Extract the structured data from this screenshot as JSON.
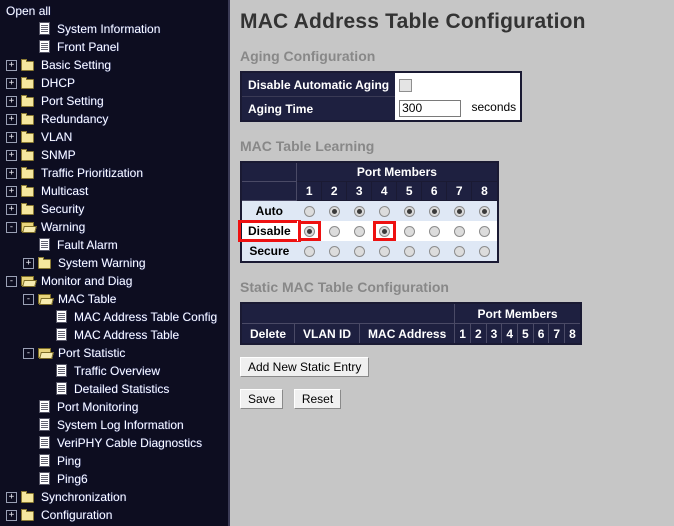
{
  "sidebar": {
    "open_all": "Open all",
    "items": [
      {
        "label": "System Information",
        "icon": "page-icon",
        "toggle": "none",
        "indent": 1
      },
      {
        "label": "Front Panel",
        "icon": "page-icon",
        "toggle": "none",
        "indent": 1
      },
      {
        "label": "Basic Setting",
        "icon": "folder-icon",
        "toggle": "+",
        "indent": 0
      },
      {
        "label": "DHCP",
        "icon": "folder-icon",
        "toggle": "+",
        "indent": 0
      },
      {
        "label": "Port Setting",
        "icon": "folder-icon",
        "toggle": "+",
        "indent": 0
      },
      {
        "label": "Redundancy",
        "icon": "folder-icon",
        "toggle": "+",
        "indent": 0
      },
      {
        "label": "VLAN",
        "icon": "folder-icon",
        "toggle": "+",
        "indent": 0
      },
      {
        "label": "SNMP",
        "icon": "folder-icon",
        "toggle": "+",
        "indent": 0
      },
      {
        "label": "Traffic Prioritization",
        "icon": "folder-icon",
        "toggle": "+",
        "indent": 0
      },
      {
        "label": "Multicast",
        "icon": "folder-icon",
        "toggle": "+",
        "indent": 0
      },
      {
        "label": "Security",
        "icon": "folder-icon",
        "toggle": "+",
        "indent": 0
      },
      {
        "label": "Warning",
        "icon": "folder-open-icon",
        "toggle": "-",
        "indent": 0
      },
      {
        "label": "Fault Alarm",
        "icon": "page-icon",
        "toggle": "none",
        "indent": 1
      },
      {
        "label": "System Warning",
        "icon": "folder-icon",
        "toggle": "+",
        "indent": 1
      },
      {
        "label": "Monitor and Diag",
        "icon": "folder-open-icon",
        "toggle": "-",
        "indent": 0
      },
      {
        "label": "MAC Table",
        "icon": "folder-open-icon",
        "toggle": "-",
        "indent": 1
      },
      {
        "label": "MAC Address Table Config",
        "icon": "page-icon",
        "toggle": "none",
        "indent": 2
      },
      {
        "label": "MAC Address Table",
        "icon": "page-icon",
        "toggle": "none",
        "indent": 2
      },
      {
        "label": "Port Statistic",
        "icon": "folder-open-icon",
        "toggle": "-",
        "indent": 1
      },
      {
        "label": "Traffic Overview",
        "icon": "page-icon",
        "toggle": "none",
        "indent": 2
      },
      {
        "label": "Detailed Statistics",
        "icon": "page-icon",
        "toggle": "none",
        "indent": 2
      },
      {
        "label": "Port Monitoring",
        "icon": "page-icon",
        "toggle": "none",
        "indent": 1
      },
      {
        "label": "System Log Information",
        "icon": "page-icon",
        "toggle": "none",
        "indent": 1
      },
      {
        "label": "VeriPHY Cable Diagnostics",
        "icon": "page-icon",
        "toggle": "none",
        "indent": 1
      },
      {
        "label": "Ping",
        "icon": "page-icon",
        "toggle": "none",
        "indent": 1
      },
      {
        "label": "Ping6",
        "icon": "page-icon",
        "toggle": "none",
        "indent": 1
      },
      {
        "label": "Synchronization",
        "icon": "folder-icon",
        "toggle": "+",
        "indent": 0
      },
      {
        "label": "Configuration",
        "icon": "folder-icon",
        "toggle": "+",
        "indent": 0
      }
    ]
  },
  "main": {
    "page_title": "MAC Address Table Configuration",
    "aging": {
      "heading": "Aging Configuration",
      "disable_label": "Disable Automatic Aging",
      "disable_checked": false,
      "time_label": "Aging Time",
      "time_value": "300",
      "time_unit": "seconds"
    },
    "learning": {
      "heading": "MAC Table Learning",
      "port_members_label": "Port Members",
      "ports": [
        "1",
        "2",
        "3",
        "4",
        "5",
        "6",
        "7",
        "8"
      ],
      "rows": [
        {
          "label": "Auto",
          "selected": [
            false,
            true,
            true,
            false,
            true,
            true,
            true,
            true
          ]
        },
        {
          "label": "Disable",
          "selected": [
            true,
            false,
            false,
            true,
            false,
            false,
            false,
            false
          ]
        },
        {
          "label": "Secure",
          "selected": [
            false,
            false,
            false,
            false,
            false,
            false,
            false,
            false
          ]
        }
      ],
      "highlight_row_label": "Disable",
      "highlight_cells": [
        "Disable-1",
        "Disable-4"
      ],
      "highlight_color": "#ee1111"
    },
    "static_table": {
      "heading": "Static MAC Table Configuration",
      "port_members_label": "Port Members",
      "columns": [
        "Delete",
        "VLAN ID",
        "MAC Address"
      ],
      "ports": [
        "1",
        "2",
        "3",
        "4",
        "5",
        "6",
        "7",
        "8"
      ],
      "rows": []
    },
    "buttons": {
      "add_new": "Add New Static Entry",
      "save": "Save",
      "reset": "Reset"
    }
  }
}
